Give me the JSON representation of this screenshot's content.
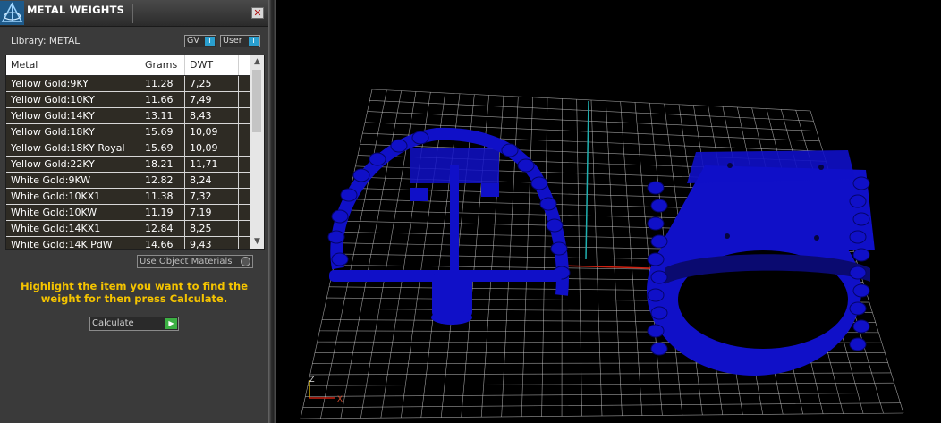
{
  "panel": {
    "title": "METAL WEIGHTS",
    "close_icon": "✕",
    "library_label": "Library: METAL",
    "gv_button": "GV",
    "user_button": "User",
    "toggle_indicator": "I",
    "columns": [
      "Metal",
      "Grams",
      "DWT"
    ],
    "rows": [
      {
        "metal": "Yellow Gold:9KY",
        "grams": "11.28",
        "dwt": "7,25"
      },
      {
        "metal": "Yellow Gold:10KY",
        "grams": "11.66",
        "dwt": "7,49"
      },
      {
        "metal": "Yellow Gold:14KY",
        "grams": "13.11",
        "dwt": "8,43"
      },
      {
        "metal": "Yellow Gold:18KY",
        "grams": "15.69",
        "dwt": "10,09"
      },
      {
        "metal": "Yellow Gold:18KY Royal",
        "grams": "15.69",
        "dwt": "10,09"
      },
      {
        "metal": "Yellow Gold:22KY",
        "grams": "18.21",
        "dwt": "11,71"
      },
      {
        "metal": "White Gold:9KW",
        "grams": "12.82",
        "dwt": "8,24"
      },
      {
        "metal": "White Gold:10KX1",
        "grams": "11.38",
        "dwt": "7,32"
      },
      {
        "metal": "White Gold:10KW",
        "grams": "11.19",
        "dwt": "7,19"
      },
      {
        "metal": "White Gold:14KX1",
        "grams": "12.84",
        "dwt": "8,25"
      },
      {
        "metal": "White Gold:14K PdW",
        "grams": "14.66",
        "dwt": "9,43"
      }
    ],
    "use_object_materials": "Use Object Materials",
    "hint": "Highlight the item you want to find the weight for then press Calculate.",
    "calculate_button": "Calculate",
    "calculate_arrow": "▶"
  },
  "viewport": {
    "axis_z": "Z",
    "axis_x": "X",
    "model_color": "#1010c8",
    "grid_color": "#cfcfcf",
    "x_axis_color": "#d02010",
    "y_axis_color": "#20b0b0"
  }
}
